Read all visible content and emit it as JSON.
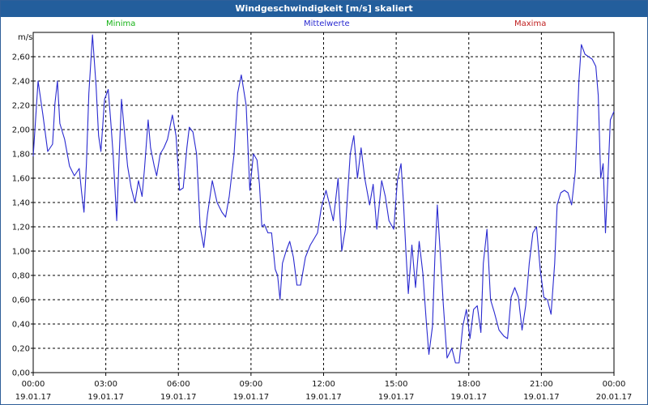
{
  "window": {
    "title": "Windgeschwindigkeit [m/s] skaliert"
  },
  "legend": [
    {
      "label": "Minima",
      "color": "#17b317"
    },
    {
      "label": "Mittelwerte",
      "color": "#2a2ad0"
    },
    {
      "label": "Maxima",
      "color": "#c02020"
    }
  ],
  "chart_data": {
    "type": "line",
    "title": "Windgeschwindigkeit [m/s] skaliert",
    "ylabel": "m/s",
    "ylim": [
      0,
      2.8
    ],
    "yticks": [
      "0,00",
      "0,20",
      "0,40",
      "0,60",
      "0,80",
      "1,00",
      "1,20",
      "1,40",
      "1,60",
      "1,80",
      "2,00",
      "2,20",
      "2,40",
      "2,60"
    ],
    "xlim_hours": [
      0,
      24
    ],
    "xticks": [
      {
        "time": "00:00",
        "date": "19.01.17"
      },
      {
        "time": "03:00",
        "date": "19.01.17"
      },
      {
        "time": "06:00",
        "date": "19.01.17"
      },
      {
        "time": "09:00",
        "date": "19.01.17"
      },
      {
        "time": "12:00",
        "date": "19.01.17"
      },
      {
        "time": "15:00",
        "date": "19.01.17"
      },
      {
        "time": "18:00",
        "date": "19.01.17"
      },
      {
        "time": "21:00",
        "date": "19.01.17"
      },
      {
        "time": "00:00",
        "date": "20.01.17"
      }
    ],
    "grid": true,
    "series": [
      {
        "name": "Mittelwerte",
        "color": "#2a2ad0",
        "points": [
          [
            0.0,
            1.78
          ],
          [
            0.2,
            2.4
          ],
          [
            0.4,
            2.12
          ],
          [
            0.6,
            1.82
          ],
          [
            0.8,
            1.88
          ],
          [
            0.9,
            2.22
          ],
          [
            1.0,
            2.4
          ],
          [
            1.1,
            2.05
          ],
          [
            1.3,
            1.92
          ],
          [
            1.5,
            1.7
          ],
          [
            1.7,
            1.62
          ],
          [
            1.9,
            1.68
          ],
          [
            2.0,
            1.48
          ],
          [
            2.1,
            1.32
          ],
          [
            2.2,
            1.72
          ],
          [
            2.3,
            2.3
          ],
          [
            2.45,
            2.78
          ],
          [
            2.6,
            2.35
          ],
          [
            2.7,
            1.95
          ],
          [
            2.8,
            1.82
          ],
          [
            2.95,
            2.25
          ],
          [
            3.1,
            2.33
          ],
          [
            3.2,
            2.08
          ],
          [
            3.3,
            1.8
          ],
          [
            3.45,
            1.25
          ],
          [
            3.55,
            1.78
          ],
          [
            3.65,
            2.25
          ],
          [
            3.8,
            1.92
          ],
          [
            3.9,
            1.7
          ],
          [
            4.05,
            1.52
          ],
          [
            4.2,
            1.4
          ],
          [
            4.35,
            1.58
          ],
          [
            4.5,
            1.45
          ],
          [
            4.6,
            1.68
          ],
          [
            4.75,
            2.08
          ],
          [
            4.85,
            1.85
          ],
          [
            5.0,
            1.7
          ],
          [
            5.1,
            1.62
          ],
          [
            5.25,
            1.8
          ],
          [
            5.4,
            1.85
          ],
          [
            5.55,
            1.92
          ],
          [
            5.75,
            2.12
          ],
          [
            5.9,
            1.95
          ],
          [
            6.05,
            1.5
          ],
          [
            6.2,
            1.52
          ],
          [
            6.35,
            1.85
          ],
          [
            6.45,
            2.02
          ],
          [
            6.6,
            1.98
          ],
          [
            6.75,
            1.8
          ],
          [
            6.9,
            1.2
          ],
          [
            7.05,
            1.03
          ],
          [
            7.2,
            1.3
          ],
          [
            7.4,
            1.58
          ],
          [
            7.6,
            1.4
          ],
          [
            7.8,
            1.32
          ],
          [
            7.95,
            1.28
          ],
          [
            8.1,
            1.45
          ],
          [
            8.3,
            1.8
          ],
          [
            8.45,
            2.3
          ],
          [
            8.6,
            2.45
          ],
          [
            8.8,
            2.2
          ],
          [
            8.95,
            1.5
          ],
          [
            9.1,
            1.8
          ],
          [
            9.25,
            1.75
          ],
          [
            9.35,
            1.55
          ],
          [
            9.45,
            1.2
          ],
          [
            9.55,
            1.22
          ],
          [
            9.7,
            1.15
          ],
          [
            9.85,
            1.15
          ],
          [
            10.0,
            0.85
          ],
          [
            10.1,
            0.8
          ],
          [
            10.2,
            0.6
          ],
          [
            10.3,
            0.9
          ],
          [
            10.45,
            1.0
          ],
          [
            10.6,
            1.08
          ],
          [
            10.75,
            0.95
          ],
          [
            10.9,
            0.72
          ],
          [
            11.05,
            0.72
          ],
          [
            11.25,
            0.95
          ],
          [
            11.45,
            1.05
          ],
          [
            11.6,
            1.1
          ],
          [
            11.75,
            1.15
          ],
          [
            11.9,
            1.35
          ],
          [
            12.1,
            1.5
          ],
          [
            12.25,
            1.38
          ],
          [
            12.4,
            1.25
          ],
          [
            12.6,
            1.6
          ],
          [
            12.75,
            1.0
          ],
          [
            12.9,
            1.18
          ],
          [
            13.1,
            1.8
          ],
          [
            13.25,
            1.95
          ],
          [
            13.4,
            1.6
          ],
          [
            13.55,
            1.85
          ],
          [
            13.7,
            1.6
          ],
          [
            13.9,
            1.38
          ],
          [
            14.05,
            1.55
          ],
          [
            14.2,
            1.18
          ],
          [
            14.4,
            1.58
          ],
          [
            14.55,
            1.45
          ],
          [
            14.7,
            1.25
          ],
          [
            14.9,
            1.18
          ],
          [
            15.05,
            1.58
          ],
          [
            15.2,
            1.72
          ],
          [
            15.3,
            1.4
          ],
          [
            15.4,
            1.0
          ],
          [
            15.5,
            0.65
          ],
          [
            15.65,
            1.05
          ],
          [
            15.8,
            0.7
          ],
          [
            15.95,
            1.08
          ],
          [
            16.1,
            0.82
          ],
          [
            16.25,
            0.4
          ],
          [
            16.35,
            0.15
          ],
          [
            16.5,
            0.38
          ],
          [
            16.6,
            0.95
          ],
          [
            16.7,
            1.38
          ],
          [
            16.8,
            1.05
          ],
          [
            16.95,
            0.55
          ],
          [
            17.1,
            0.12
          ],
          [
            17.3,
            0.2
          ],
          [
            17.45,
            0.08
          ],
          [
            17.6,
            0.08
          ],
          [
            17.75,
            0.38
          ],
          [
            17.9,
            0.52
          ],
          [
            18.05,
            0.28
          ],
          [
            18.2,
            0.52
          ],
          [
            18.35,
            0.55
          ],
          [
            18.5,
            0.33
          ],
          [
            18.6,
            0.9
          ],
          [
            18.75,
            1.18
          ],
          [
            18.9,
            0.6
          ],
          [
            19.05,
            0.5
          ],
          [
            19.25,
            0.35
          ],
          [
            19.45,
            0.3
          ],
          [
            19.6,
            0.28
          ],
          [
            19.75,
            0.62
          ],
          [
            19.9,
            0.7
          ],
          [
            20.05,
            0.62
          ],
          [
            20.2,
            0.35
          ],
          [
            20.35,
            0.55
          ],
          [
            20.5,
            0.9
          ],
          [
            20.65,
            1.15
          ],
          [
            20.8,
            1.2
          ],
          [
            20.95,
            0.85
          ],
          [
            21.1,
            0.62
          ],
          [
            21.25,
            0.6
          ],
          [
            21.4,
            0.48
          ],
          [
            21.55,
            0.9
          ],
          [
            21.65,
            1.38
          ],
          [
            21.8,
            1.48
          ],
          [
            21.95,
            1.5
          ],
          [
            22.1,
            1.48
          ],
          [
            22.25,
            1.38
          ],
          [
            22.4,
            1.65
          ],
          [
            22.55,
            2.4
          ],
          [
            22.65,
            2.7
          ],
          [
            22.8,
            2.62
          ],
          [
            22.95,
            2.6
          ],
          [
            23.1,
            2.58
          ],
          [
            23.25,
            2.52
          ],
          [
            23.35,
            2.28
          ],
          [
            23.45,
            1.6
          ],
          [
            23.55,
            1.72
          ],
          [
            23.65,
            1.15
          ],
          [
            23.75,
            1.6
          ],
          [
            23.85,
            2.08
          ],
          [
            24.0,
            2.15
          ]
        ]
      }
    ]
  }
}
